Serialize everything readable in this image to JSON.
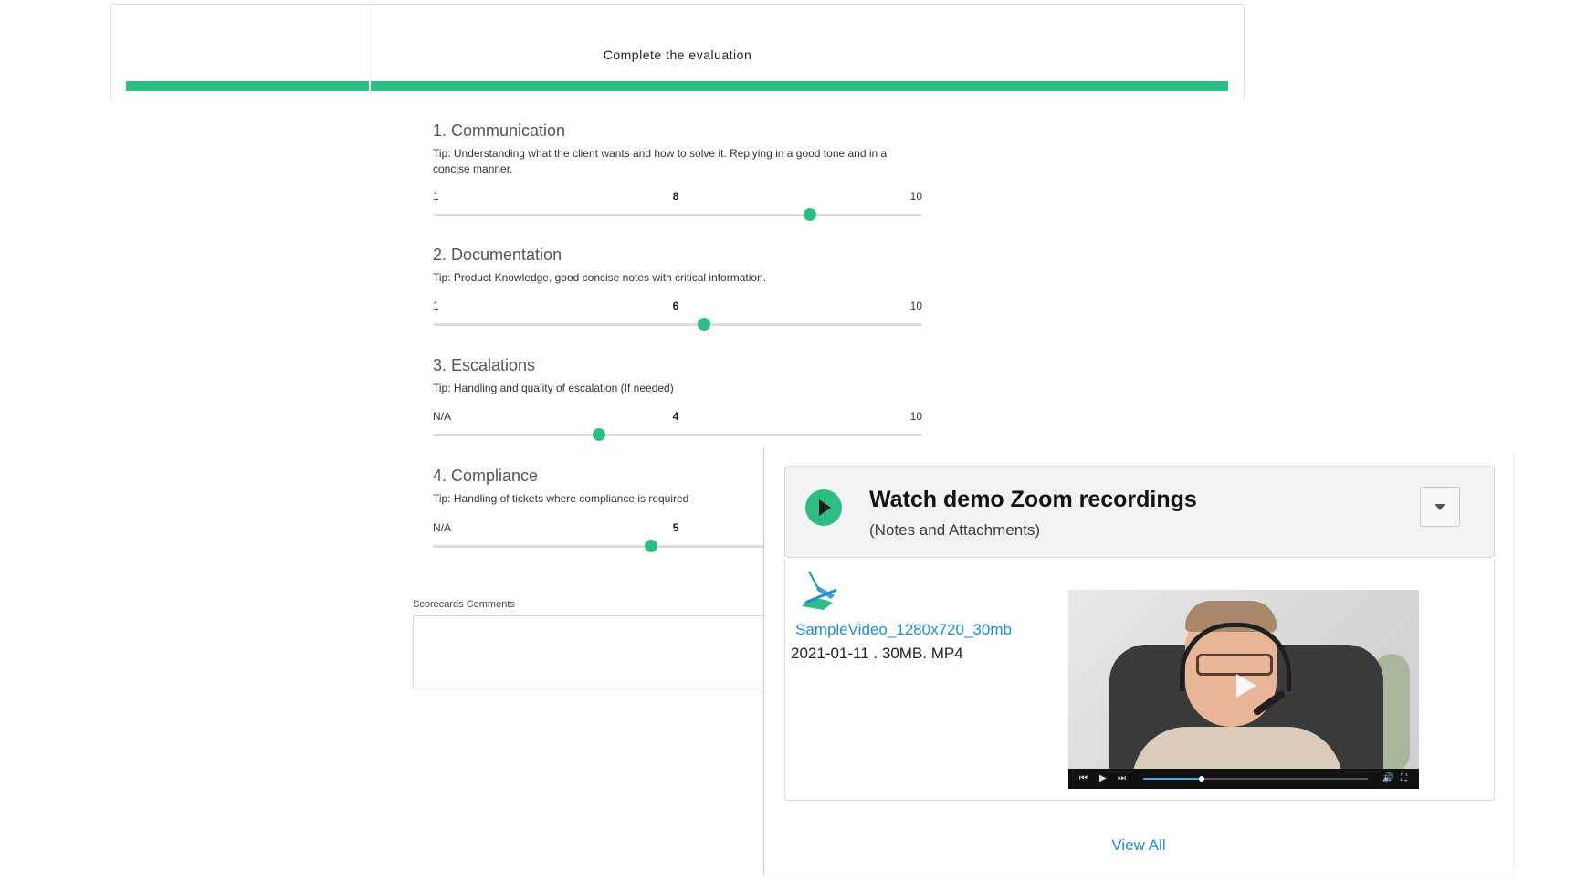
{
  "evaluation": {
    "title": "Complete the evaluation",
    "questions": [
      {
        "title": "1. Communication",
        "tip": "Tip: Understanding what the client wants and how to solve it. Replying in a good tone and in a concise manner.",
        "min": "1",
        "max": "10",
        "value": "8",
        "value_fraction": 0.77
      },
      {
        "title": "2. Documentation",
        "tip": "Tip: Product Knowledge, good concise notes with critical information.",
        "min": "1",
        "max": "10",
        "value": "6",
        "value_fraction": 0.555
      },
      {
        "title": "3. Escalations",
        "tip": "Tip: Handling and quality of escalation (If needed)",
        "min": "N/A",
        "max": "10",
        "value": "4",
        "value_fraction": 0.34
      },
      {
        "title": "4. Compliance",
        "tip": "Tip: Handling of tickets where compliance is required",
        "min": "N/A",
        "max": "",
        "value": "5",
        "value_fraction": 0.445
      }
    ],
    "comments_label": "Scorecards Comments",
    "comments_value": ""
  },
  "recordings": {
    "title": "Watch demo Zoom recordings",
    "subtitle": "(Notes and Attachments)",
    "file": {
      "name": "SampleVideo_1280x720_30mb",
      "meta": "2021-01-11 . 30MB. MP4",
      "playback_progress": 0.26
    },
    "view_all": "View All"
  },
  "colors": {
    "accent": "#2ebd85",
    "link": "#1b8fd4"
  }
}
